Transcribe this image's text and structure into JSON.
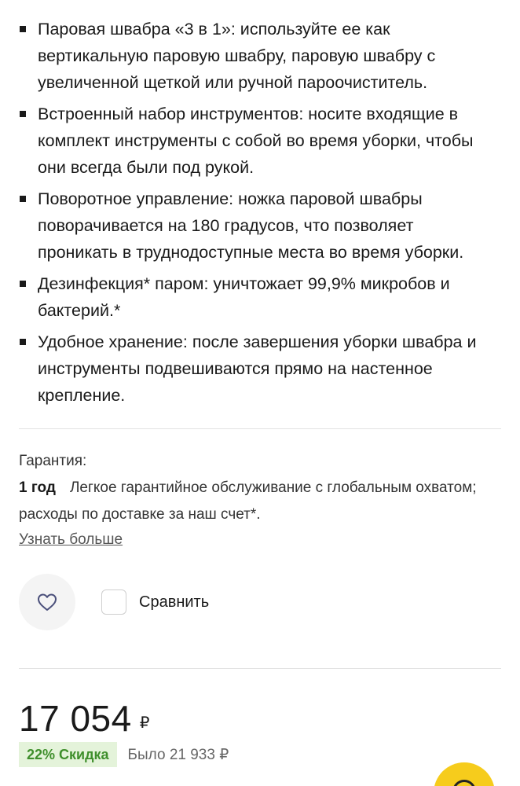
{
  "features": [
    "Паровая швабра «3 в 1»: используйте ее как вертикальную паровую швабру, паровую швабру с увеличенной щеткой или ручной пароочиститель.",
    "Встроенный набор инструментов: носите входящие в комплект инструменты с собой во время уборки, чтобы они всегда были под рукой.",
    "Поворотное управление: ножка паровой швабры поворачивается на 180 градусов, что позволяет проникать в труднодоступные места во время уборки.",
    "Дезинфекция* паром: уничтожает 99,9% микробов и бактерий.*",
    "Удобное хранение: после завершения уборки швабра и инструменты подвешиваются прямо на настенное крепление."
  ],
  "warranty": {
    "label": "Гарантия:",
    "term": "1 год",
    "description": "Легкое гарантийное обслуживание с глобальным охватом; расходы по доставке за наш счет*.",
    "learn_more": "Узнать больше"
  },
  "actions": {
    "favorite_icon": "heart-icon",
    "compare_label": "Сравнить"
  },
  "price": {
    "current": "17 054",
    "currency": "₽",
    "discount": "22% Скидка",
    "old_price": "Было 21 933 ₽"
  },
  "colors": {
    "discount_bg": "#e4f3da",
    "discount_text": "#3f8f2c",
    "fab": "#f6cc1c"
  }
}
